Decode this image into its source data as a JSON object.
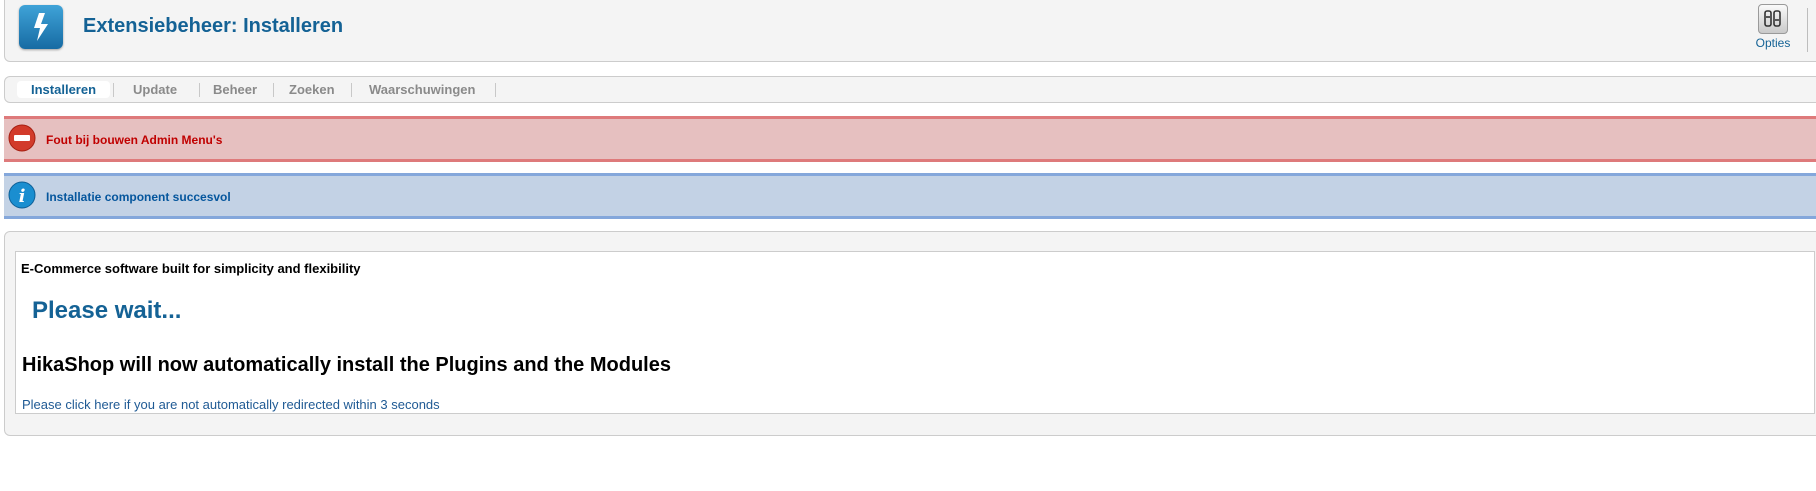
{
  "header": {
    "title": "Extensiebeheer: Installeren",
    "app_icon": "lightning-icon",
    "options_label": "Opties",
    "options_icon": "options-toggle-icon"
  },
  "tabs": [
    {
      "label": "Installeren",
      "active": true
    },
    {
      "label": "Update",
      "active": false
    },
    {
      "label": "Beheer",
      "active": false
    },
    {
      "label": "Zoeken",
      "active": false
    },
    {
      "label": "Waarschuwingen",
      "active": false
    }
  ],
  "messages": {
    "error": {
      "text": "Fout bij bouwen Admin Menu's",
      "icon": "error-minus-icon",
      "color": "#c00000"
    },
    "info": {
      "text": "Installatie component succesvol",
      "icon": "info-icon",
      "color": "#05569d"
    }
  },
  "content": {
    "tagline": "E-Commerce software built for simplicity and flexibility",
    "wait": "Please wait...",
    "install_message": "HikaShop will now automatically install the Plugins and the Modules",
    "redirect_link": "Please click here if you are not automatically redirected within 3 seconds"
  },
  "colors": {
    "accent": "#146295",
    "error_bg": "#e6c0c0",
    "info_bg": "#c3d2e5"
  }
}
